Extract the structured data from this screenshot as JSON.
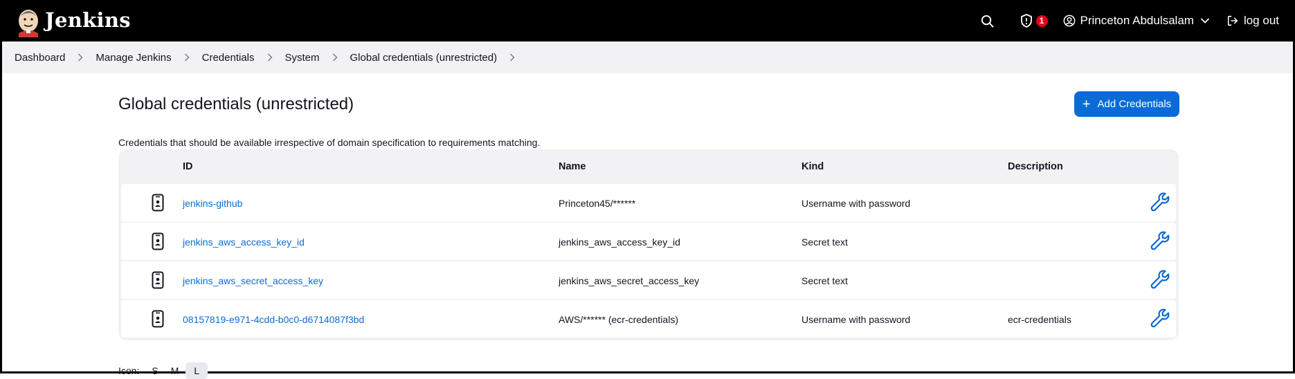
{
  "header": {
    "brand": "Jenkins",
    "notification_count": "1",
    "user_name": "Princeton Abdulsalam",
    "logout_label": "log out"
  },
  "breadcrumb": [
    "Dashboard",
    "Manage Jenkins",
    "Credentials",
    "System",
    "Global credentials (unrestricted)"
  ],
  "page": {
    "title": "Global credentials (unrestricted)",
    "add_button": "Add Credentials",
    "description": "Credentials that should be available irrespective of domain specification to requirements matching."
  },
  "table": {
    "headers": [
      "ID",
      "Name",
      "Kind",
      "Description"
    ],
    "rows": [
      {
        "id": "jenkins-github",
        "name": "Princeton45/******",
        "kind": "Username with password",
        "description": ""
      },
      {
        "id": "jenkins_aws_access_key_id",
        "name": "jenkins_aws_access_key_id",
        "kind": "Secret text",
        "description": ""
      },
      {
        "id": "jenkins_aws_secret_access_key",
        "name": "jenkins_aws_secret_access_key",
        "kind": "Secret text",
        "description": ""
      },
      {
        "id": "08157819-e971-4cdd-b0c0-d6714087f3bd",
        "name": "AWS/****** (ecr-credentials)",
        "kind": "Username with password",
        "description": "ecr-credentials"
      }
    ]
  },
  "icon_size": {
    "label": "Icon:",
    "options": [
      "S",
      "M",
      "L"
    ]
  },
  "colors": {
    "accent": "#0b6bd6",
    "header_bg": "#000000",
    "badge": "#e6001f"
  }
}
